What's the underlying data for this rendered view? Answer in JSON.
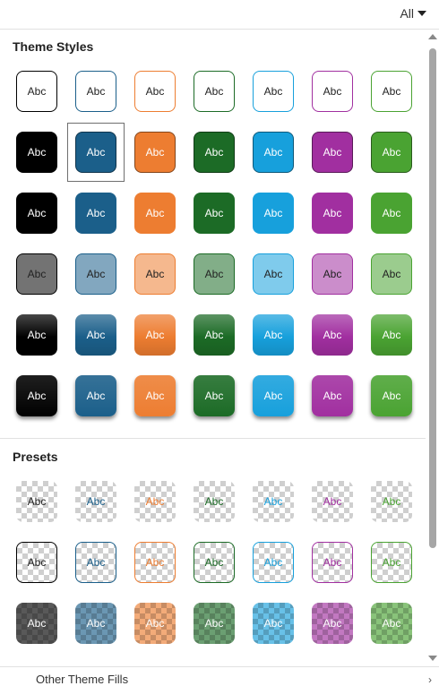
{
  "header": {
    "filter_label": "All"
  },
  "sections": [
    {
      "title": "Theme Styles"
    },
    {
      "title": "Presets"
    }
  ],
  "swatch_text": "Abc",
  "colors": [
    "#000000",
    "#1b5f8a",
    "#ed7d31",
    "#1c6b26",
    "#17a0dc",
    "#a12fa0",
    "#4aa332"
  ],
  "footer": {
    "label": "Other Theme Fills"
  }
}
